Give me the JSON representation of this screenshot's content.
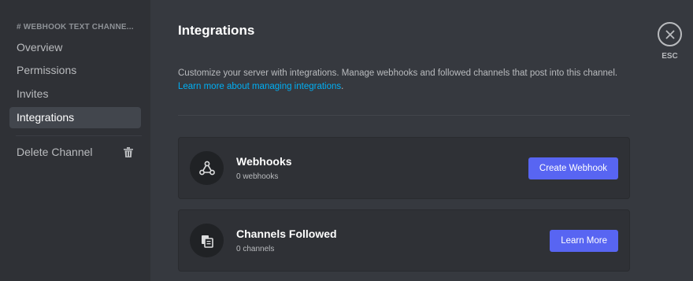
{
  "sidebar": {
    "header": "# WEBHOOK TEXT CHANNE...",
    "items": [
      {
        "label": "Overview"
      },
      {
        "label": "Permissions"
      },
      {
        "label": "Invites"
      },
      {
        "label": "Integrations"
      }
    ],
    "delete_label": "Delete Channel"
  },
  "main": {
    "title": "Integrations",
    "description": "Customize your server with integrations. Manage webhooks and followed channels that post into this channel.",
    "link": "Learn more about managing integrations",
    "link_suffix": ".",
    "cards": [
      {
        "title": "Webhooks",
        "subtitle": "0 webhooks",
        "button": "Create Webhook",
        "icon": "webhook-icon"
      },
      {
        "title": "Channels Followed",
        "subtitle": "0 channels",
        "button": "Learn More",
        "icon": "channels-followed-icon"
      }
    ]
  },
  "close": {
    "label": "ESC"
  },
  "colors": {
    "sidebar_bg": "#2f3136",
    "main_bg": "#36393f",
    "accent": "#5865f2",
    "link": "#00aff4"
  }
}
